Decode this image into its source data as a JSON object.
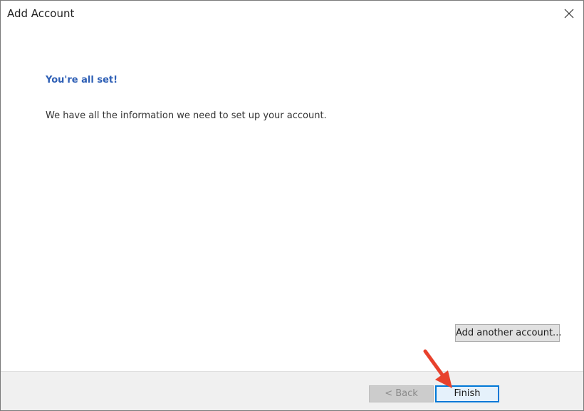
{
  "window": {
    "title": "Add Account",
    "close_icon": "close-icon"
  },
  "content": {
    "heading": "You're all set!",
    "message": "We have all the information we need to set up your account.",
    "add_another_label": "Add another account..."
  },
  "footer": {
    "back_label": "< Back",
    "back_enabled": false,
    "finish_label": "Finish"
  },
  "annotation": {
    "arrow_icon": "red-pointer-arrow-icon",
    "arrow_color": "#e8412c"
  },
  "colors": {
    "heading": "#2e5fb5",
    "focus_border": "#0078d7",
    "footer_bg": "#f0f0f0"
  }
}
